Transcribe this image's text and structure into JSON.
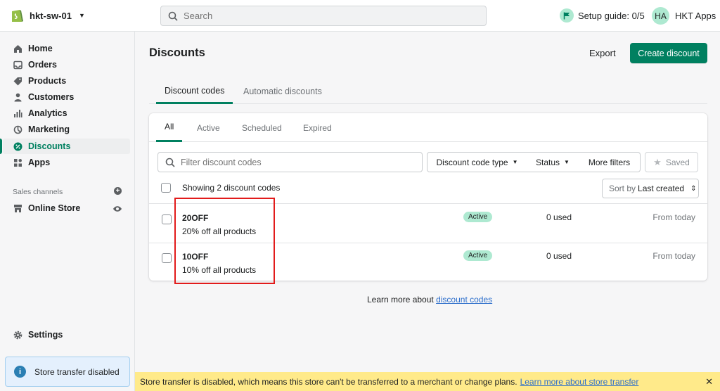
{
  "topbar": {
    "store_name": "hkt-sw-01",
    "search_placeholder": "Search",
    "setup_guide": "Setup guide: 0/5",
    "avatar_initials": "HA",
    "account_name": "HKT Apps"
  },
  "sidebar": {
    "items": [
      {
        "label": "Home",
        "icon": "home-icon"
      },
      {
        "label": "Orders",
        "icon": "orders-icon"
      },
      {
        "label": "Products",
        "icon": "products-icon"
      },
      {
        "label": "Customers",
        "icon": "customers-icon"
      },
      {
        "label": "Analytics",
        "icon": "analytics-icon"
      },
      {
        "label": "Marketing",
        "icon": "marketing-icon"
      },
      {
        "label": "Discounts",
        "icon": "discounts-icon"
      },
      {
        "label": "Apps",
        "icon": "apps-icon"
      }
    ],
    "active_item": "Discounts",
    "sales_channels_label": "Sales channels",
    "online_store": "Online Store",
    "settings": "Settings",
    "store_transfer": "Store transfer disabled"
  },
  "page": {
    "title": "Discounts",
    "export_label": "Export",
    "create_label": "Create discount"
  },
  "main_tabs": [
    "Discount codes",
    "Automatic discounts"
  ],
  "sub_tabs": [
    "All",
    "Active",
    "Scheduled",
    "Expired"
  ],
  "filters": {
    "placeholder": "Filter discount codes",
    "type_label": "Discount code type",
    "status_label": "Status",
    "more_label": "More filters",
    "saved_label": "Saved"
  },
  "list": {
    "showing_text": "Showing 2 discount codes",
    "sort_prefix": "Sort by",
    "sort_value": "Last created",
    "rows": [
      {
        "code": "20OFF",
        "description": "20% off all products",
        "status": "Active",
        "usage": "0 used",
        "period": "From today"
      },
      {
        "code": "10OFF",
        "description": "10% off all products",
        "status": "Active",
        "usage": "0 used",
        "period": "From today"
      }
    ]
  },
  "learn_more": {
    "text": "Learn more about",
    "link": "discount codes"
  },
  "banner": {
    "text": "Store transfer is disabled, which means this store can't be transferred to a merchant or change plans.",
    "link": "Learn more about store transfer"
  },
  "colors": {
    "accent": "#008060",
    "badge": "#aee9d1",
    "banner": "#ffea8a",
    "highlight": "#e21b1b"
  }
}
